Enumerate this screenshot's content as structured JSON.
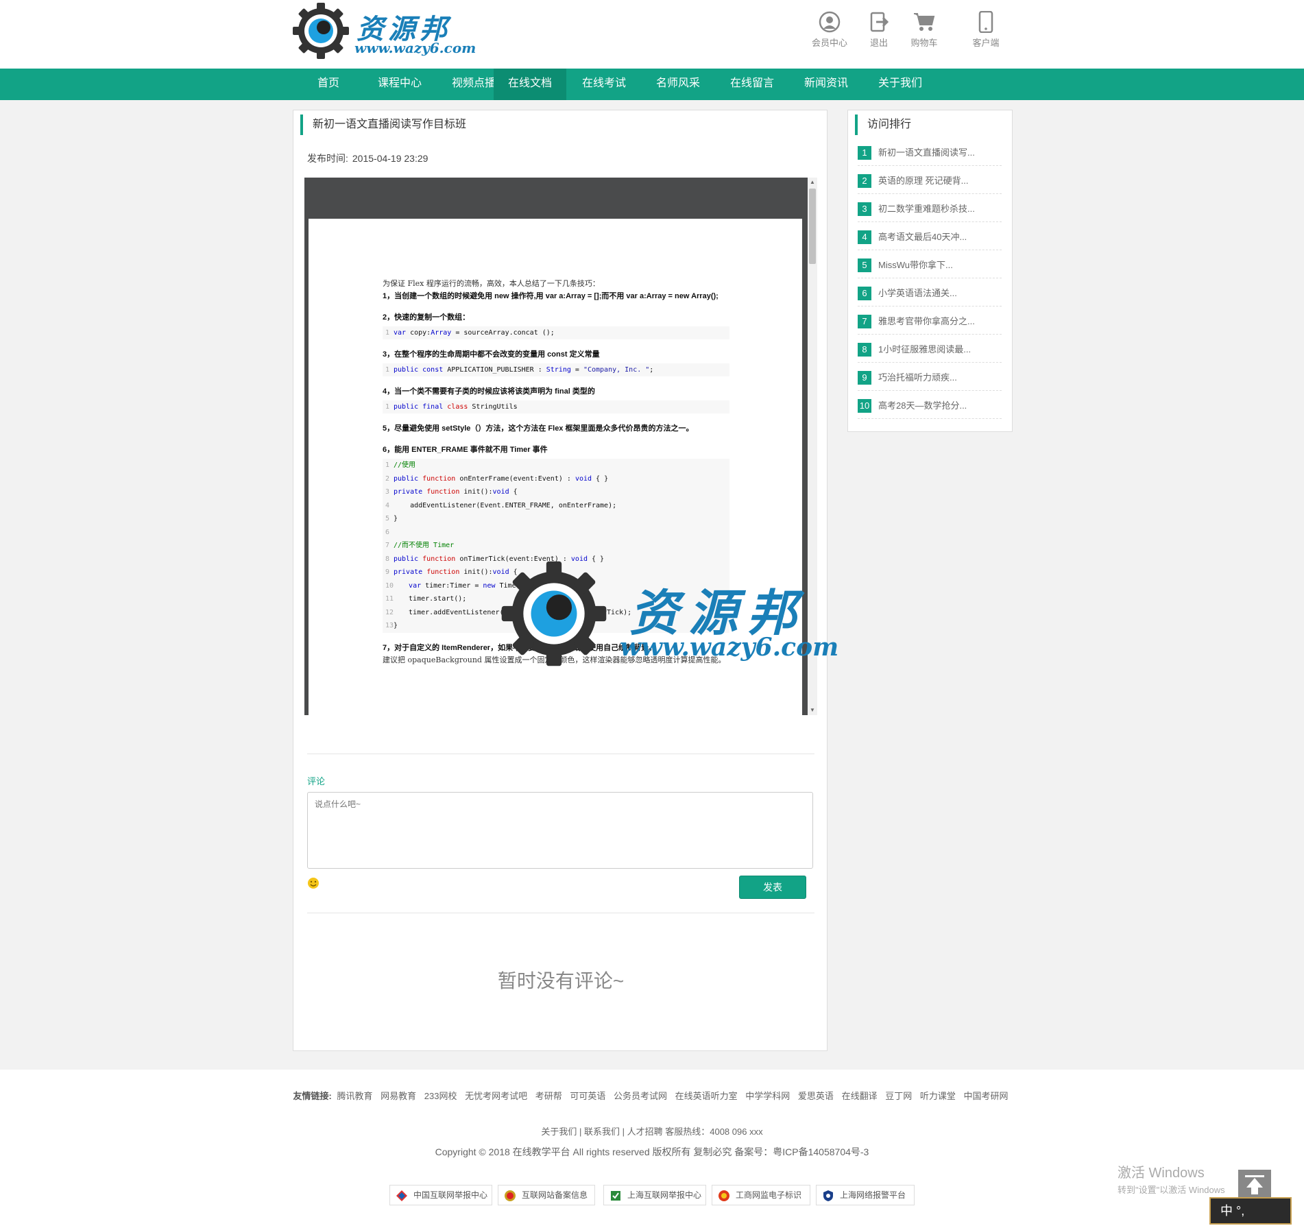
{
  "header": {
    "brand": "资源邦",
    "domain": "www.wazy6.com",
    "icons": [
      {
        "icon": "user-circle-icon",
        "label": "会员中心"
      },
      {
        "icon": "logout-icon",
        "label": "退出"
      },
      {
        "icon": "cart-icon",
        "label": "购物车"
      },
      {
        "icon": "mobile-icon",
        "label": "客户端"
      }
    ]
  },
  "nav": {
    "items": [
      "首页",
      "课程中心",
      "视频点播",
      "在线文档",
      "在线考试",
      "名师风采",
      "在线留言",
      "新闻资讯",
      "关于我们"
    ],
    "active_index": 3
  },
  "doc": {
    "title": "新初一语文直播阅读写作目标班",
    "pub_label": "发布时间:",
    "pub_time": "2015-04-19 23:29",
    "intro": "为保证 Flex 程序运行的流畅，高效，本人总结了一下几条技巧：",
    "h1": "1，当创建一个数组的时候避免用 new 操作符,用 var a:Array = [];而不用 var a:Array = new Array();",
    "h2": "2，快速的复制一个数组：",
    "h3": "3，在整个程序的生命周期中都不会改变的变量用 const 定义常量",
    "h4": "4，当一个类不需要有子类的时候应该将该类声明为 final 类型的",
    "h5": "5，尽量避免使用 setStyle（）方法，这个方法在 Flex 框架里面是众多代价昂贵的方法之一。",
    "h6": "6，能用 ENTER_FRAME 事件就不用 Timer 事件",
    "h7": "7，对于自定义的 ItemRenderer，如果不需要背景透明，或者使用自己绘制背景。",
    "t7": "建议把 opaqueBackground 属性设置成一个固定的颜色，这样渲染器能够忽略透明度计算提高性能。"
  },
  "watermark": {
    "brand": "资源邦",
    "domain": "www.wazy6.com"
  },
  "comment": {
    "label": "评论",
    "placeholder": "说点什么吧~",
    "submit": "发表",
    "empty": "暂时没有评论~"
  },
  "sidebar": {
    "title": "访问排行",
    "items": [
      {
        "num": "1",
        "text": "新初一语文直播阅读写..."
      },
      {
        "num": "2",
        "text": "英语的原理 死记硬背..."
      },
      {
        "num": "3",
        "text": "初二数学重难题秒杀技..."
      },
      {
        "num": "4",
        "text": "高考语文最后40天冲..."
      },
      {
        "num": "5",
        "text": "MissWu带你拿下..."
      },
      {
        "num": "6",
        "text": "小学英语语法通关..."
      },
      {
        "num": "7",
        "text": "雅思考官带你拿高分之..."
      },
      {
        "num": "8",
        "text": "1小时征服雅思阅读最..."
      },
      {
        "num": "9",
        "text": "巧治托福听力顽疾..."
      },
      {
        "num": "10",
        "text": "高考28天—数学抢分..."
      }
    ]
  },
  "footer": {
    "friend_label": "友情链接:",
    "friend_links": [
      "腾讯教育",
      "网易教育",
      "233网校",
      "无忧考网考试吧",
      "考研帮",
      "可可英语",
      "公务员考试网",
      "在线英语听力室",
      "中学学科网",
      "爱思英语",
      "在线翻译",
      "豆丁网",
      "听力课堂",
      "中国考研网"
    ],
    "links_line": "关于我们 | 联系我们 | 人才招聘   客服热线：4008 096 xxx",
    "copyright": "Copyright © 2018 在线教学平台 All rights reserved 版权所有 复制必究 备案号：粤ICP备14058704号-3",
    "badges": [
      "中国互联网举报中心",
      "互联网站备案信息",
      "上海互联网举报中心",
      "工商网监电子标识",
      "上海网络报警平台"
    ]
  },
  "system": {
    "win_activate": "激活 Windows",
    "win_hint": "转到\"设置\"以激活 Windows",
    "ime": "中 °,"
  },
  "colors": {
    "accent": "#12a386",
    "accent_dark": "#0c8d72",
    "brand_blue": "#1a7fb8"
  }
}
